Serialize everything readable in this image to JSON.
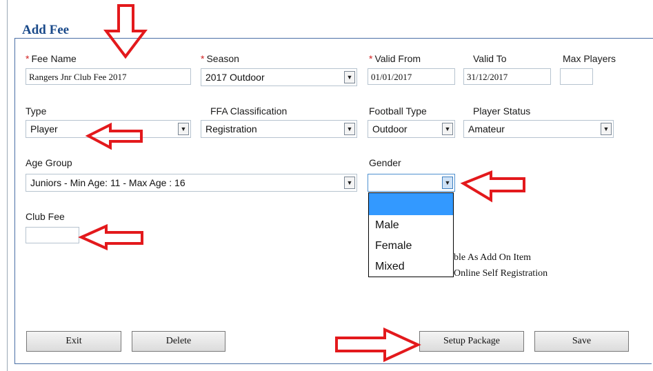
{
  "title": "Add Fee",
  "required_marker": "*",
  "fields": {
    "fee_name": {
      "label": "Fee Name",
      "value": "Rangers Jnr Club Fee 2017"
    },
    "season": {
      "label": "Season",
      "value": "2017 Outdoor"
    },
    "valid_from": {
      "label": "Valid From",
      "value": "01/01/2017"
    },
    "valid_to": {
      "label": "Valid To",
      "value": "31/12/2017"
    },
    "max_players": {
      "label": "Max Players",
      "value": ""
    },
    "type": {
      "label": "Type",
      "value": "Player"
    },
    "ffa_classification": {
      "label": "FFA Classification",
      "value": "Registration"
    },
    "football_type": {
      "label": "Football Type",
      "value": "Outdoor"
    },
    "player_status": {
      "label": "Player Status",
      "value": "Amateur"
    },
    "age_group": {
      "label": "Age Group",
      "value": "Juniors - Min Age: 11 - Max Age : 16"
    },
    "gender": {
      "label": "Gender",
      "value": "",
      "options": [
        "",
        "Male",
        "Female",
        "Mixed"
      ]
    },
    "club_fee": {
      "label": "Club Fee",
      "value": ""
    }
  },
  "partial_texts": {
    "add_on": "ble As Add On Item",
    "online_reg": "Online Self Registration"
  },
  "buttons": {
    "exit": "Exit",
    "delete": "Delete",
    "setup_package": "Setup Package",
    "save": "Save"
  },
  "colors": {
    "title": "#1a4a8a",
    "required": "#d21f1f",
    "annotation_arrow": "#e3191c",
    "dropdown_highlight": "#3399ff"
  }
}
